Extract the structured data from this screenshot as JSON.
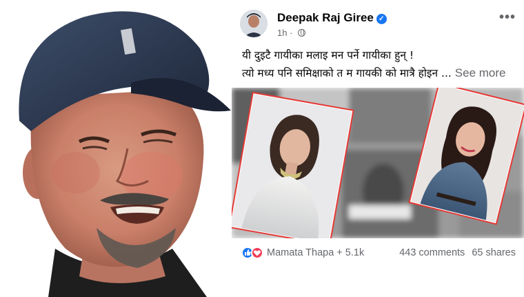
{
  "post": {
    "author": "Deepak Raj Giree",
    "time": "1h",
    "lines": [
      "यी दुइटै गायीका मलाइ मन पर्ने गायीका हुन् !",
      "त्यो मध्य पनि समिक्षाको त म गायकी को मात्रै होइन ..."
    ],
    "see_more": "See more",
    "reactions": "Mamata Thapa + 5.1k",
    "comments": "443 comments",
    "shares": "65 shares"
  },
  "icons": {
    "verified": "verified-badge-icon",
    "privacy": "globe-icon",
    "menu": "more-options-icon",
    "like": "like-reaction-icon",
    "love": "love-reaction-icon"
  },
  "colors": {
    "accent": "#1877f2",
    "love": "#f33e58",
    "frame": "#e53935",
    "muted": "#65676b",
    "text": "#050505"
  }
}
